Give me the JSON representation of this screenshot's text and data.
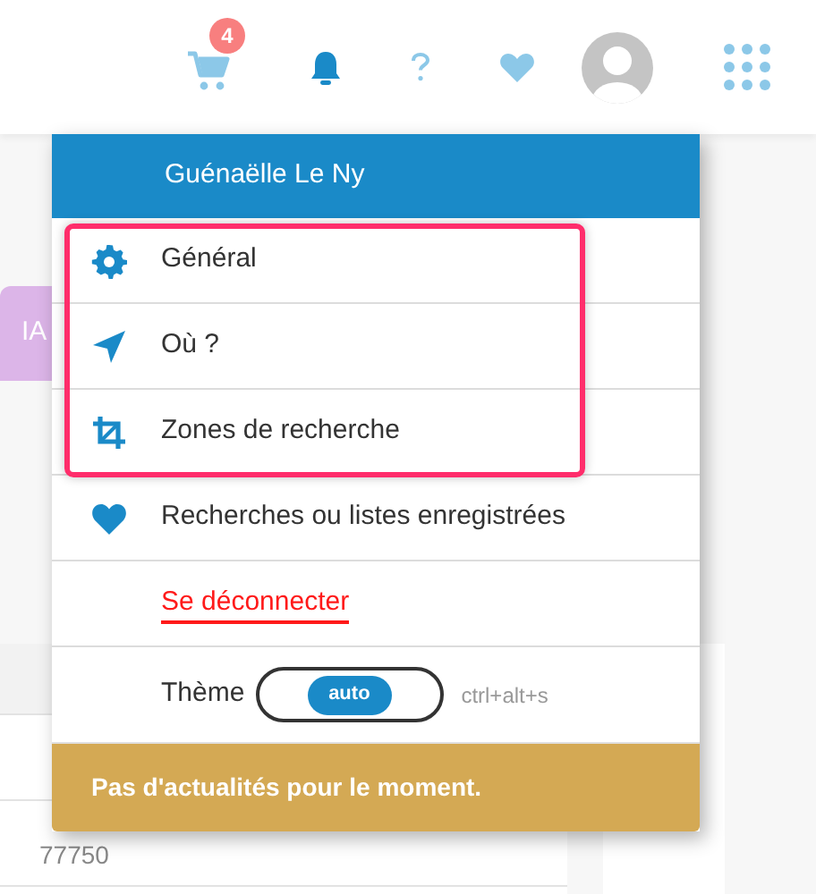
{
  "header": {
    "cart_count": "4"
  },
  "background": {
    "tag": "IA",
    "table": {
      "rows": [
        "77750"
      ]
    }
  },
  "user_menu": {
    "user_name": "Guénaëlle Le Ny",
    "items": [
      {
        "kind": "settings",
        "label": "Général",
        "highlighted": true
      },
      {
        "kind": "location",
        "label": "Où ?",
        "highlighted": true
      },
      {
        "kind": "crop",
        "label": "Zones de recherche",
        "highlighted": true
      },
      {
        "kind": "favorites",
        "label": "Recherches ou listes enregistrées",
        "highlighted": false
      },
      {
        "kind": "logout",
        "label": "Se déconnecter",
        "highlighted": false
      }
    ],
    "theme": {
      "label": "Thème",
      "value": "auto",
      "shortcut": "ctrl+alt+s"
    },
    "news": "Pas d'actualités pour le moment."
  }
}
